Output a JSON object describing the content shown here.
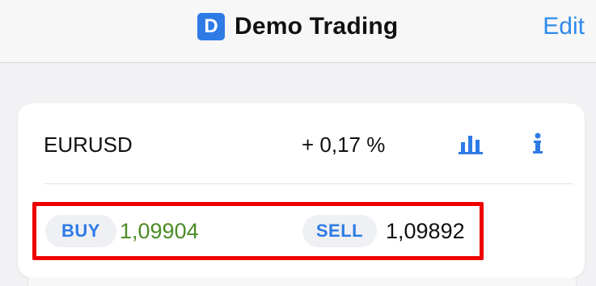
{
  "header": {
    "account_badge": "D",
    "title": "Demo Trading",
    "edit_label": "Edit"
  },
  "instrument": {
    "symbol": "EURUSD",
    "change": "+ 0,17 %",
    "buy_label": "BUY",
    "buy_price": "1,09904",
    "sell_label": "SELL",
    "sell_price": "1,09892"
  },
  "icons": {
    "chart": "bar-chart-icon",
    "info": "info-icon"
  },
  "colors": {
    "accent": "#2e7be6",
    "buy_price": "#4c8c25",
    "highlight": "#ee0000"
  }
}
